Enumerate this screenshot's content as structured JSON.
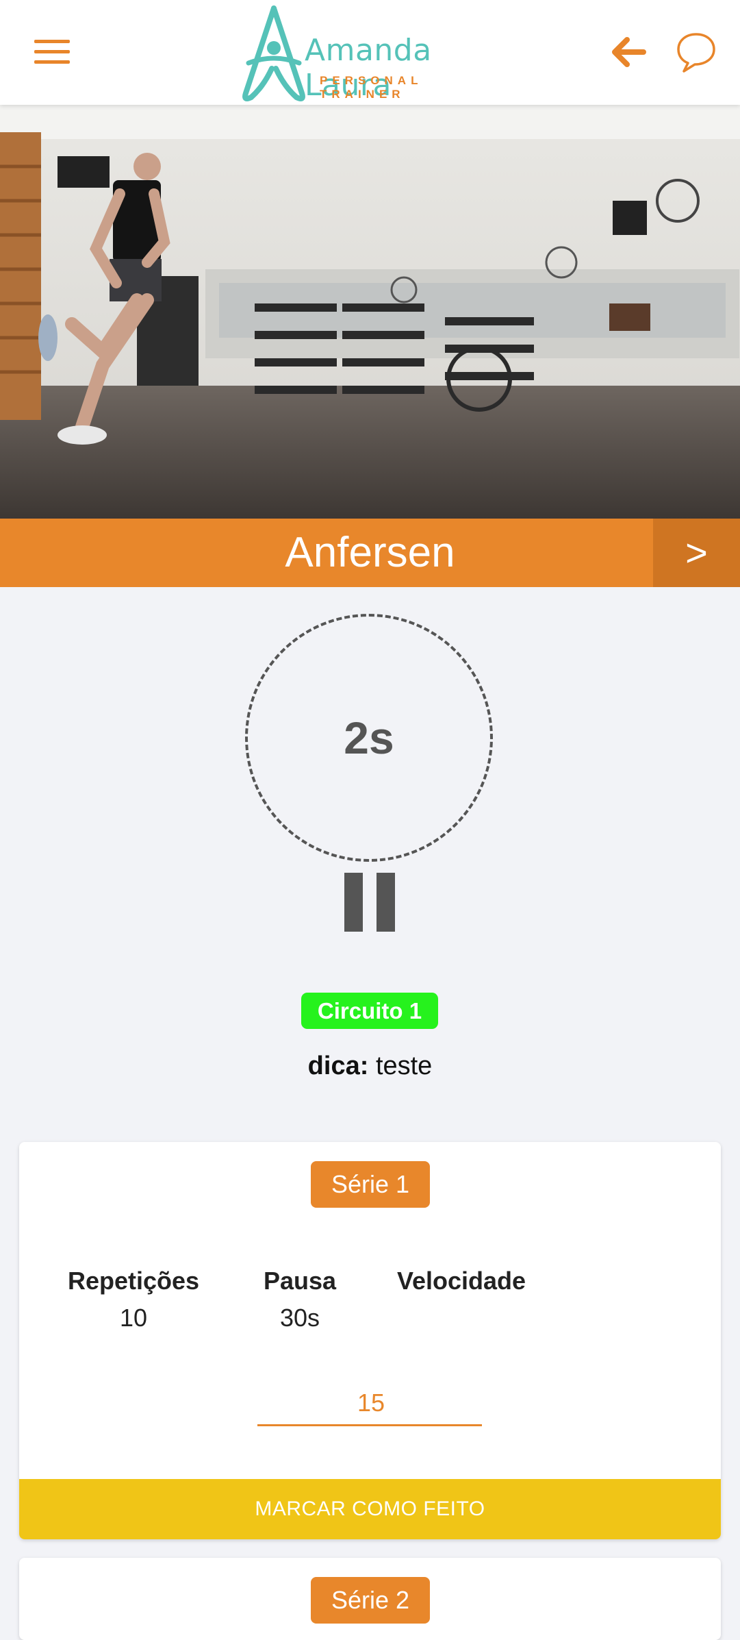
{
  "header": {
    "logo_main": "Amanda Laura",
    "logo_sub": "PERSONAL TRAINER",
    "menu_icon": "hamburger-icon",
    "back_icon": "arrow-left-icon",
    "chat_icon": "chat-bubble-icon"
  },
  "exercise": {
    "name": "Anfersen",
    "next_label": ">"
  },
  "timer": {
    "value": "2s",
    "pause_icon": "pause-icon"
  },
  "circuit": {
    "label": "Circuito 1"
  },
  "tip": {
    "label": "dica:",
    "text": "teste"
  },
  "series": [
    {
      "title": "Série 1",
      "repetitions_label": "Repetições",
      "repetitions_value": "10",
      "pause_label": "Pausa",
      "pause_value": "30s",
      "speed_label": "Velocidade",
      "speed_value": "",
      "input_value": "15",
      "done_label": "MARCAR COMO FEITO"
    },
    {
      "title": "Série 2"
    }
  ],
  "colors": {
    "accent": "#e8872b",
    "teal": "#55c2b8",
    "circuit_badge": "#26f21d",
    "done_button": "#f0c517"
  }
}
